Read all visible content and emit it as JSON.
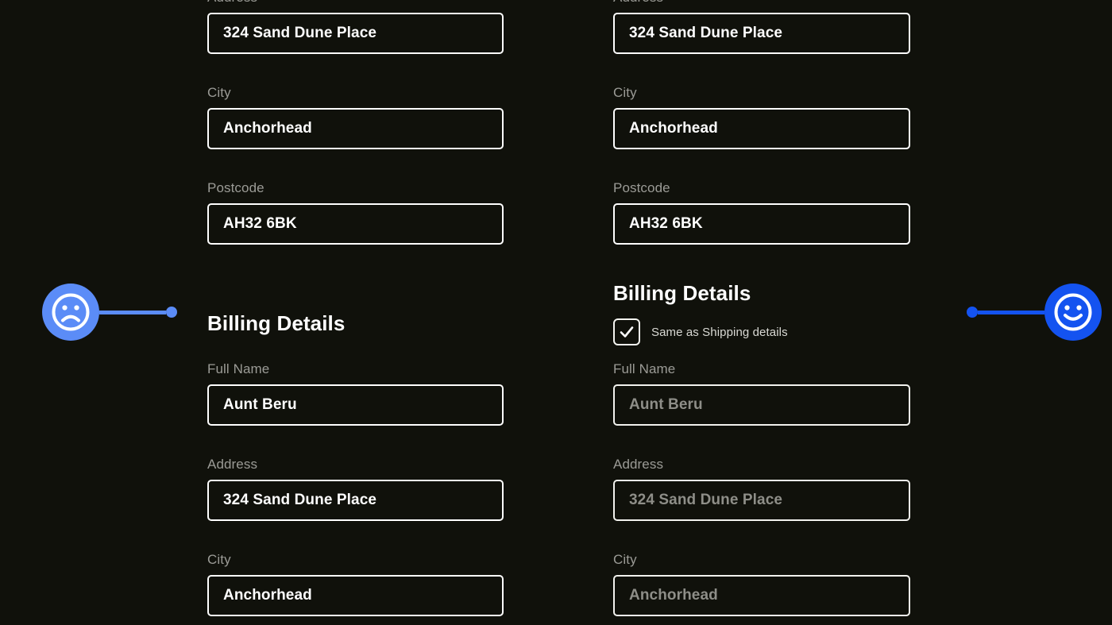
{
  "background_color": "#10110b",
  "accent_colors": {
    "negative_marker": "#5b8cf7",
    "positive_marker": "#1453f0",
    "field_border": "#ffffff",
    "label_text": "#9b9b96",
    "value_text": "#ffffff",
    "disabled_value_text": "#8e8e88"
  },
  "columns": {
    "left": {
      "variant": "without-same-as-shipping",
      "shipping_fields": [
        {
          "label": "Address",
          "value": "324 Sand Dune Place",
          "disabled": false
        },
        {
          "label": "City",
          "value": "Anchorhead",
          "disabled": false
        },
        {
          "label": "Postcode",
          "value": "AH32 6BK",
          "disabled": false
        }
      ],
      "billing_heading": "Billing Details",
      "billing_fields": [
        {
          "label": "Full Name",
          "value": "Aunt Beru",
          "disabled": false
        },
        {
          "label": "Address",
          "value": "324 Sand Dune Place",
          "disabled": false
        },
        {
          "label": "City",
          "value": "Anchorhead",
          "disabled": false
        }
      ]
    },
    "right": {
      "variant": "with-same-as-shipping",
      "shipping_fields": [
        {
          "label": "Address",
          "value": "324 Sand Dune Place",
          "disabled": false
        },
        {
          "label": "City",
          "value": "Anchorhead",
          "disabled": false
        },
        {
          "label": "Postcode",
          "value": "AH32 6BK",
          "disabled": false
        }
      ],
      "billing_heading": "Billing Details",
      "checkbox": {
        "label": "Same as Shipping details",
        "checked": true,
        "icon": "checkmark-icon"
      },
      "billing_fields": [
        {
          "label": "Full Name",
          "value": "Aunt Beru",
          "disabled": true
        },
        {
          "label": "Address",
          "value": "324 Sand Dune Place",
          "disabled": true
        },
        {
          "label": "City",
          "value": "Anchorhead",
          "disabled": true
        }
      ]
    }
  },
  "markers": {
    "negative": {
      "icon": "sad-face-icon",
      "color": "#5b8cf7"
    },
    "positive": {
      "icon": "happy-face-icon",
      "color": "#1453f0"
    }
  }
}
